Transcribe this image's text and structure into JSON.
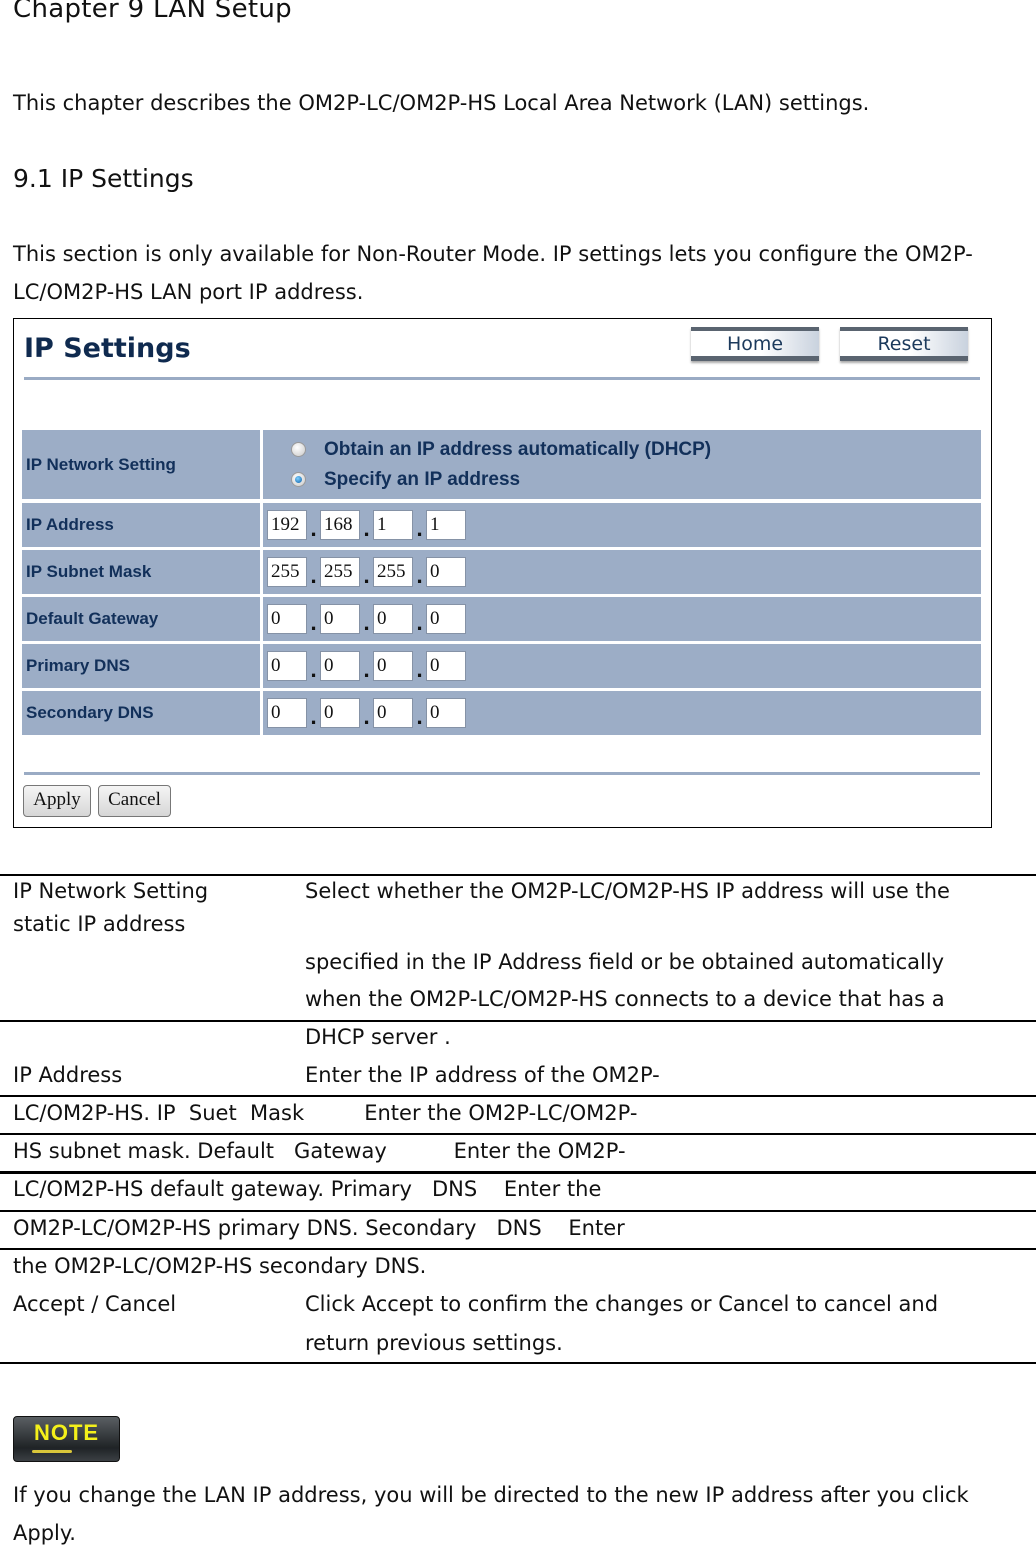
{
  "chapter_title": "Chapter  9 LAN  Setup",
  "intro": "This chapter describes the OM2P-LC/OM2P-HS Local Area Network (LAN) settings.",
  "section_title": "9.1 IP  Settings",
  "section_text": [
    "This section is only available for Non-Router  Mode. IP settings lets you configure the OM2P-",
    "LC/OM2P-HS LAN port IP address."
  ],
  "screenshot": {
    "title": "IP Settings",
    "home_label": "Home",
    "reset_label": "Reset",
    "network_setting": {
      "label": "IP Network Setting",
      "options": [
        {
          "label": "Obtain an IP address automatically (DHCP)",
          "selected": false
        },
        {
          "label": "Specify an IP address",
          "selected": true
        }
      ]
    },
    "fields": [
      {
        "label": "IP Address",
        "octets": [
          "192",
          "168",
          "1",
          "1"
        ]
      },
      {
        "label": "IP Subnet Mask",
        "octets": [
          "255",
          "255",
          "255",
          "0"
        ]
      },
      {
        "label": "Default Gateway",
        "octets": [
          "0",
          "0",
          "0",
          "0"
        ]
      },
      {
        "label": "Primary DNS",
        "octets": [
          "0",
          "0",
          "0",
          "0"
        ]
      },
      {
        "label": "Secondary DNS",
        "octets": [
          "0",
          "0",
          "0",
          "0"
        ]
      }
    ],
    "apply_label": "Apply",
    "cancel_label": "Cancel"
  },
  "description_lines": {
    "l1_left": "IP Network  Setting",
    "l1_right": "Select whether the OM2P-LC/OM2P-HS IP address will use the",
    "l2_left": "static IP address",
    "l3_right": "specified in the IP  Address  field or be obtained automatically",
    "l4_right": "when the OM2P-LC/OM2P-HS connects to a device that has a",
    "l5_right": "DHCP server .",
    "l6_left": "IP  Address",
    "l6_right": "Enter the IP address of the OM2P-",
    "l7": "LC/OM2P-HS. IP  Suet  Mask         Enter the OM2P-LC/OM2P-",
    "l8": "HS subnet mask. Default   Gateway          Enter the OM2P-",
    "l9": "LC/OM2P-HS default gateway. Primary   DNS    Enter the",
    "l10": "OM2P-LC/OM2P-HS primary DNS. Secondary   DNS    Enter",
    "l11": "the OM2P-LC/OM2P-HS secondary DNS.",
    "l12_left": "Accept  / Cancel",
    "l12_right": "Click Accept  to confirm the changes or Cancel  to cancel and",
    "l13_right": "return previous settings."
  },
  "note": {
    "badge": "NOTE",
    "text": [
      "If you change the LAN IP address, you will be directed to the new IP address after you click",
      "Apply."
    ]
  }
}
